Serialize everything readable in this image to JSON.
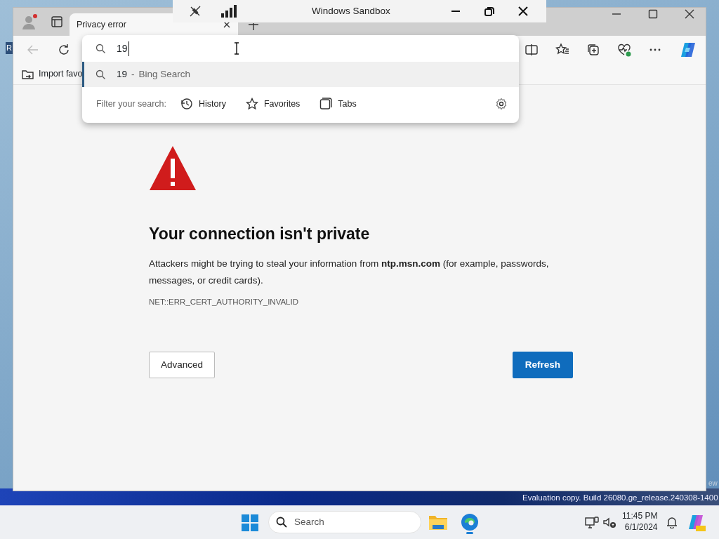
{
  "desktop": {
    "icon_label": "R",
    "corner_text": "ew",
    "watermark": "Evaluation copy. Build 26080.ge_release.240308-1400"
  },
  "sandbox_window": {
    "title": "Windows Sandbox"
  },
  "browser": {
    "tabs": [
      {
        "title": "Privacy error",
        "selected": true
      }
    ],
    "address_dropdown": {
      "query": "19",
      "suggestions": [
        {
          "query": "19",
          "separator": "-",
          "source": "Bing Search",
          "selected": true
        }
      ],
      "filter_label": "Filter your search:",
      "filters": [
        {
          "kind": "history",
          "label": "History"
        },
        {
          "kind": "favorites",
          "label": "Favorites"
        },
        {
          "kind": "tabs",
          "label": "Tabs"
        }
      ]
    },
    "bookmarks_bar": {
      "items": [
        "Import favo"
      ]
    },
    "error_page": {
      "heading": "Your connection isn't private",
      "message": "Attackers might be trying to steal your information from **ntp.msn.com** (for example, passwords, messages, or credit cards).",
      "error_code": "NET::ERR_CERT_AUTHORITY_INVALID",
      "buttons": [
        {
          "kind": "secondary",
          "label": "Advanced"
        },
        {
          "kind": "primary",
          "label": "Refresh"
        }
      ]
    }
  },
  "taskbar": {
    "search_placeholder": "Search",
    "time": "11:45 PM",
    "date": "6/1/2024"
  }
}
